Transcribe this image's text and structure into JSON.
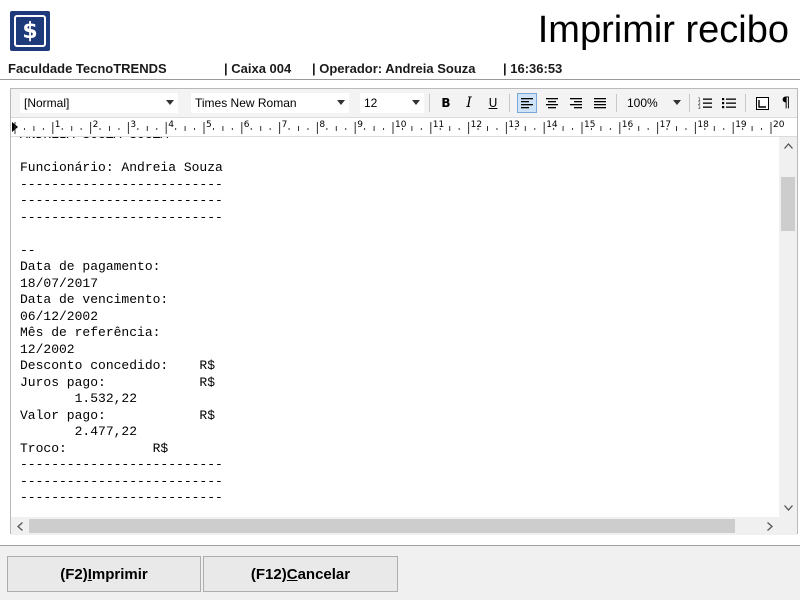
{
  "header": {
    "title": "Imprimir recibo",
    "logo_symbol": "$",
    "logo_color": "#1d3a7a"
  },
  "status": {
    "institution": "Faculdade TecnoTRENDS",
    "cashier": "| Caixa 004",
    "operator": "| Operador: Andreia Souza",
    "time": "| 16:36:53"
  },
  "toolbar": {
    "style_value": "[Normal]",
    "font_value": "Times New Roman",
    "size_value": "12",
    "zoom_value": "100%",
    "bold_label": "B",
    "italic_label": "I",
    "underline_label": "U",
    "active_alignment": "align-left"
  },
  "ruler": {
    "labels": [
      "1",
      "2",
      "3",
      "4",
      "5",
      "6",
      "7",
      "8",
      "9",
      "10",
      "11",
      "12",
      "13",
      "14",
      "15",
      "16",
      "17",
      "18",
      "19",
      "20"
    ]
  },
  "document": {
    "lines": [
      "ANDREIA SOUZA SOUZA",
      "",
      "Funcionário: Andreia Souza",
      "--------------------------",
      "--------------------------",
      "--------------------------",
      "",
      "--",
      "Data de pagamento:",
      "18/07/2017",
      "Data de vencimento:",
      "06/12/2002",
      "Mês de referência:",
      "12/2002",
      "Desconto concedido:    R$",
      "Juros pago:            R$",
      "       1.532,22",
      "Valor pago:            R$",
      "       2.477,22",
      "Troco:           R$",
      "--------------------------",
      "--------------------------",
      "--------------------------"
    ]
  },
  "buttons": {
    "print_prefix": "(F2) ",
    "print_underlined": "I",
    "print_rest": "mprimir",
    "cancel_prefix": "(F12) ",
    "cancel_underlined": "C",
    "cancel_rest": "ancelar"
  }
}
